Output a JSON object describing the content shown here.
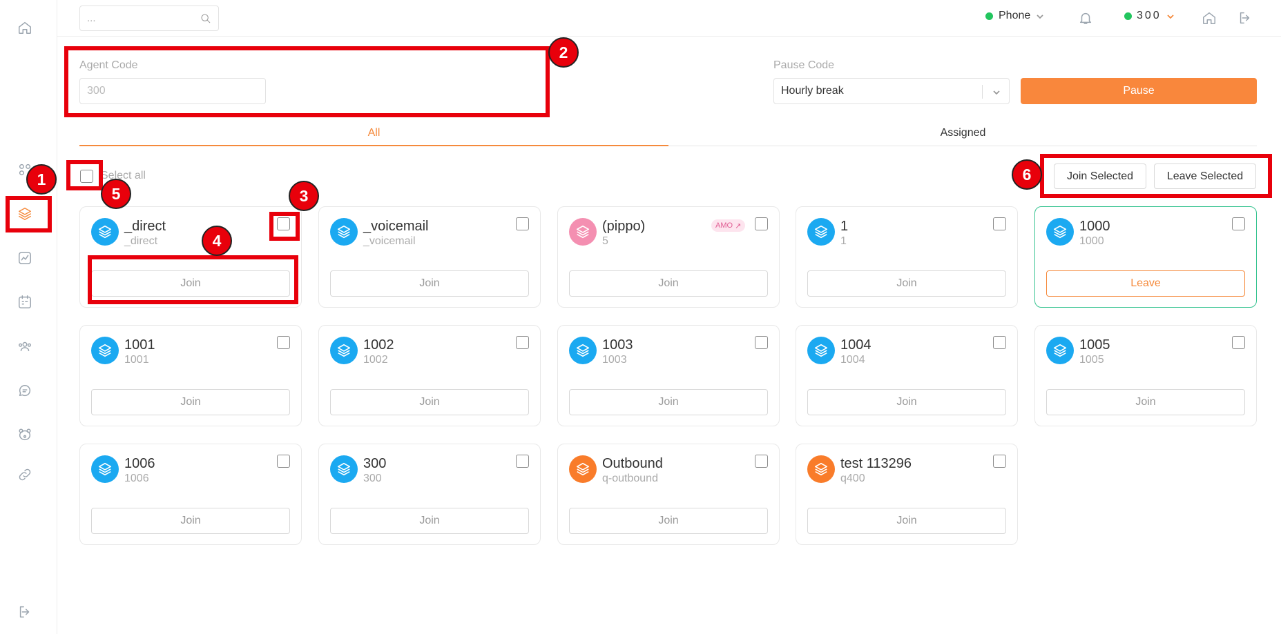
{
  "search": {
    "placeholder": "..."
  },
  "topbar": {
    "phone_label": "Phone",
    "agent_number": "300",
    "status_color": "#22c55e"
  },
  "agent": {
    "label": "Agent Code",
    "value": "300"
  },
  "pause": {
    "label": "Pause Code",
    "selected": "Hourly break",
    "button": "Pause"
  },
  "tabs": [
    {
      "label": "All"
    },
    {
      "label": "Assigned"
    }
  ],
  "bulk": {
    "select_all": "Select all",
    "join_selected": "Join Selected",
    "leave_selected": "Leave Selected"
  },
  "queues": [
    {
      "name": "_direct",
      "sub": "_direct",
      "action": "Join",
      "color": "blue"
    },
    {
      "name": "_voicemail",
      "sub": "_voicemail",
      "action": "Join",
      "color": "blue"
    },
    {
      "name": "(pippo)",
      "sub": "5",
      "action": "Join",
      "color": "pink",
      "badge": "AMO"
    },
    {
      "name": "1",
      "sub": "1",
      "action": "Join",
      "color": "blue"
    },
    {
      "name": "1000",
      "sub": "1000",
      "action": "Leave",
      "color": "blue",
      "joined": true
    },
    {
      "name": "1001",
      "sub": "1001",
      "action": "Join",
      "color": "blue"
    },
    {
      "name": "1002",
      "sub": "1002",
      "action": "Join",
      "color": "blue"
    },
    {
      "name": "1003",
      "sub": "1003",
      "action": "Join",
      "color": "blue"
    },
    {
      "name": "1004",
      "sub": "1004",
      "action": "Join",
      "color": "blue"
    },
    {
      "name": "1005",
      "sub": "1005",
      "action": "Join",
      "color": "blue"
    },
    {
      "name": "1006",
      "sub": "1006",
      "action": "Join",
      "color": "blue"
    },
    {
      "name": "300",
      "sub": "300",
      "action": "Join",
      "color": "blue"
    },
    {
      "name": "Outbound",
      "sub": "q-outbound",
      "action": "Join",
      "color": "orange"
    },
    {
      "name": "test 113296",
      "sub": "q400",
      "action": "Join",
      "color": "orange"
    }
  ],
  "annotations": [
    "1",
    "2",
    "3",
    "4",
    "5",
    "6"
  ],
  "colors": {
    "accent": "#f58a3c",
    "annotation": "#e8000b",
    "queue_blue": "#1ba9f1",
    "active_border": "#34c38f"
  }
}
